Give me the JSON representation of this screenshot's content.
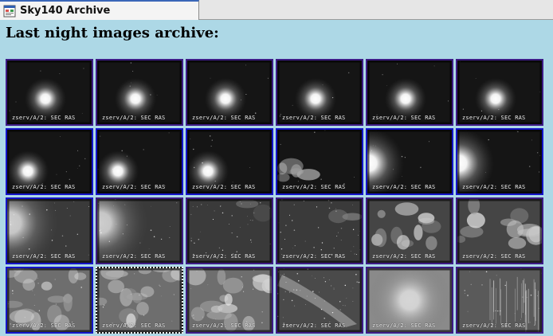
{
  "tab": {
    "title": "Sky140 Archive",
    "icon": "web-page-icon"
  },
  "page": {
    "heading": "Last night images archive:"
  },
  "colors": {
    "background": "#add8e6",
    "link_border": "#3d1b85",
    "active_border": "#1414c8"
  },
  "thumbnails": [
    {
      "caption": "zserv/A/2: SEC RAS",
      "scene": "moon"
    },
    {
      "caption": "zserv/A/2: SEC RAS",
      "scene": "moon"
    },
    {
      "caption": "zserv/A/2: SEC RAS",
      "scene": "moon"
    },
    {
      "caption": "zserv/A/2: SEC RAS",
      "scene": "moon"
    },
    {
      "caption": "zserv/A/2: SEC RAS",
      "scene": "moon"
    },
    {
      "caption": "zserv/A/2: SEC RAS",
      "scene": "moon"
    },
    {
      "caption": "zserv/A/2: SEC RAS",
      "scene": "moon-low"
    },
    {
      "caption": "zserv/A/2: SEC RAS",
      "scene": "moon-low"
    },
    {
      "caption": "zserv/A/2: SEC RAS",
      "scene": "moon-low"
    },
    {
      "caption": "zserv/A/2: SEC RAS",
      "scene": "cloud-low"
    },
    {
      "caption": "zserv/A/2: SEC RAS",
      "scene": "moon-edge"
    },
    {
      "caption": "zserv/A/2: SEC RAS",
      "scene": "moon-edge"
    },
    {
      "caption": "zserv/A/2: SEC RAS",
      "scene": "glow"
    },
    {
      "caption": "zserv/A/2: SEC RAS",
      "scene": "glow"
    },
    {
      "caption": "zserv/A/2: SEC RAS",
      "scene": "stars"
    },
    {
      "caption": "zserv/A/2: SEC RAS",
      "scene": "stars"
    },
    {
      "caption": "zserv/A/2: SEC RAS",
      "scene": "clouds"
    },
    {
      "caption": "zserv/A/2: SEC RAS",
      "scene": "clouds"
    },
    {
      "caption": "zserv/A/2: SEC RAS",
      "scene": "overcast"
    },
    {
      "caption": "zserv/A/2: SEC RAS",
      "scene": "overcast"
    },
    {
      "caption": "zserv/A/2: SEC RAS",
      "scene": "overcast"
    },
    {
      "caption": "zserv/A/2: SEC RAS",
      "scene": "milkyway"
    },
    {
      "caption": "zserv/A/2: SEC RAS",
      "scene": "bright"
    },
    {
      "caption": "zserv/A/2: SEC RAS",
      "scene": "streaks"
    }
  ]
}
